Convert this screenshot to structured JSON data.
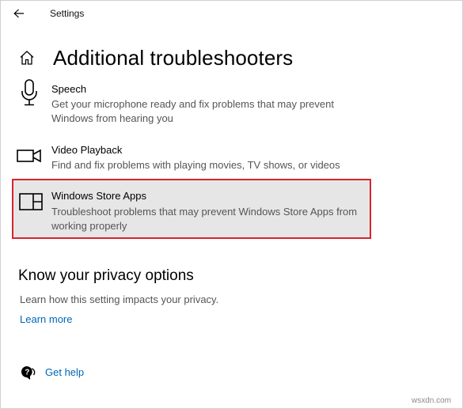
{
  "window": {
    "title": "Settings"
  },
  "page": {
    "title": "Additional troubleshooters"
  },
  "troubleshooters": [
    {
      "title": "Speech",
      "description": "Get your microphone ready and fix problems that may prevent Windows from hearing you",
      "icon": "microphone-icon"
    },
    {
      "title": "Video Playback",
      "description": "Find and fix problems with playing movies, TV shows, or videos",
      "icon": "video-camera-icon"
    },
    {
      "title": "Windows Store Apps",
      "description": "Troubleshoot problems that may prevent Windows Store Apps from working properly",
      "icon": "store-apps-icon",
      "highlighted": true,
      "highlight_color": "#d9232c"
    }
  ],
  "privacy": {
    "heading": "Know your privacy options",
    "description": "Learn how this setting impacts your privacy.",
    "link": "Learn more"
  },
  "help": {
    "label": "Get help",
    "icon": "get-help-icon"
  },
  "watermark": "wsxdn.com",
  "colors": {
    "accent": "#0067b8",
    "highlight_border": "#d9232c",
    "selected_bg": "#e6e6e6"
  }
}
